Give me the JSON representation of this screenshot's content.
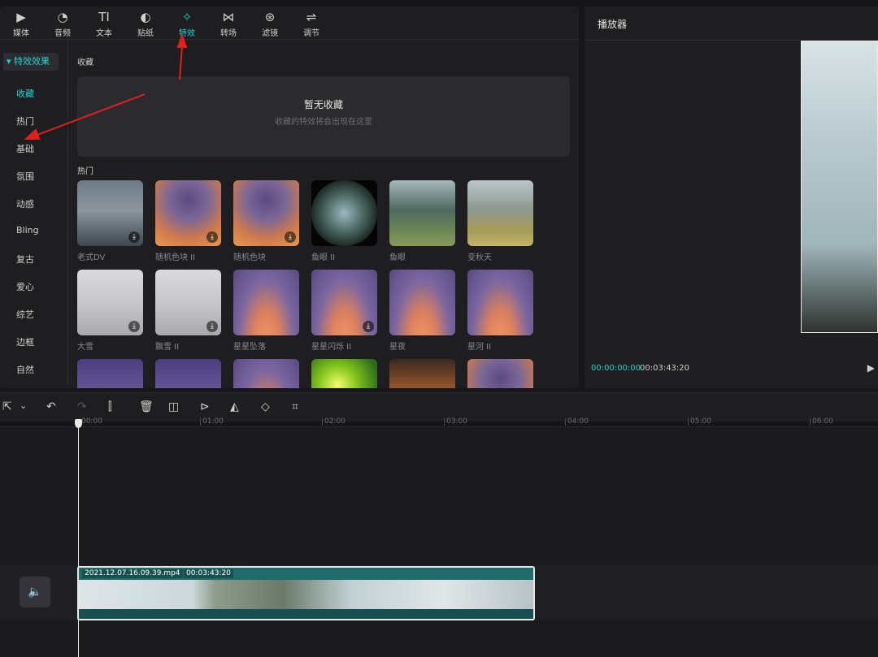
{
  "toolbar": {
    "tabs": [
      {
        "label": "媒体",
        "icon": "▶",
        "icon_name": "media-icon"
      },
      {
        "label": "音频",
        "icon": "◔",
        "icon_name": "audio-icon"
      },
      {
        "label": "文本",
        "icon": "TI",
        "icon_name": "text-icon"
      },
      {
        "label": "贴纸",
        "icon": "◐",
        "icon_name": "sticker-icon"
      },
      {
        "label": "特效",
        "icon": "✧",
        "icon_name": "effects-icon"
      },
      {
        "label": "转场",
        "icon": "⋈",
        "icon_name": "transition-icon"
      },
      {
        "label": "滤镜",
        "icon": "⊛",
        "icon_name": "filter-icon"
      },
      {
        "label": "调节",
        "icon": "⇌",
        "icon_name": "adjust-icon"
      }
    ],
    "active_tab": "特效"
  },
  "sidebar": {
    "header": "▾ 特效效果",
    "items": [
      "收藏",
      "热门",
      "基础",
      "氛围",
      "动感",
      "Bling",
      "复古",
      "爱心",
      "综艺",
      "边框",
      "自然"
    ],
    "active_item": "收藏"
  },
  "content": {
    "favorites_title": "收藏",
    "favorites_empty_title": "暂无收藏",
    "favorites_empty_hint": "收藏的特效将会出现在这里",
    "hot_title": "热门",
    "effects": [
      {
        "label": "老式DV",
        "download": true
      },
      {
        "label": "随机色块 II",
        "download": true
      },
      {
        "label": "随机色块",
        "download": true
      },
      {
        "label": "鱼眼 II",
        "download": false
      },
      {
        "label": "鱼眼",
        "download": false
      },
      {
        "label": "变秋天",
        "download": false
      },
      {
        "label": "大雪",
        "download": true
      },
      {
        "label": "飘雪 II",
        "download": true
      },
      {
        "label": "星星坠落",
        "download": false
      },
      {
        "label": "星星闪烁 II",
        "download": true
      },
      {
        "label": "星夜",
        "download": false
      },
      {
        "label": "星河 II",
        "download": false
      }
    ],
    "download_icon": "⤓"
  },
  "player": {
    "title": "播放器",
    "current_time": "00:00:00:00",
    "total_time": "00:03:43:20",
    "play_icon": "▶"
  },
  "timeline": {
    "tools": [
      "⇱",
      "⌄",
      "↶",
      "↷",
      "⫿",
      "🗑",
      "◫",
      "⊳",
      "◭",
      "◇",
      "⌗"
    ],
    "ruler": [
      "00:00",
      "01:00",
      "02:00",
      "03:00",
      "04:00",
      "05:00",
      "06:00"
    ],
    "clip_name": "2021.12.07.16.09.39.mp4",
    "clip_duration": "00:03:43:20",
    "audio_icon": "🔈"
  },
  "colors": {
    "accent": "#22d3d3",
    "annotation_arrow": "#e02020",
    "panel_bg": "#1e1e21",
    "clip": "#1c5d5c"
  }
}
